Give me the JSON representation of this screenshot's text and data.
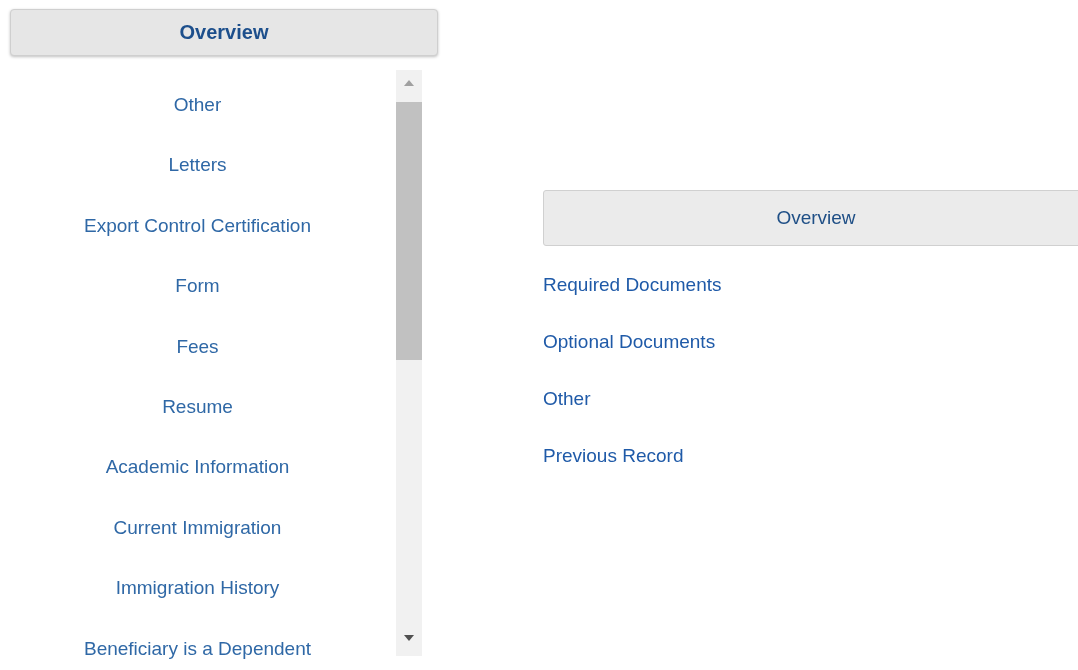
{
  "left_panel": {
    "header": "Overview",
    "items": [
      "Other",
      "Letters",
      "Export Control Certification",
      "Form",
      "Fees",
      "Resume",
      "Academic Information",
      "Current Immigration",
      "Immigration History",
      "Beneficiary is a Dependent"
    ]
  },
  "right_panel": {
    "header": "Overview",
    "items": [
      "Required Documents",
      "Optional Documents",
      "Other",
      "Previous Record"
    ]
  }
}
